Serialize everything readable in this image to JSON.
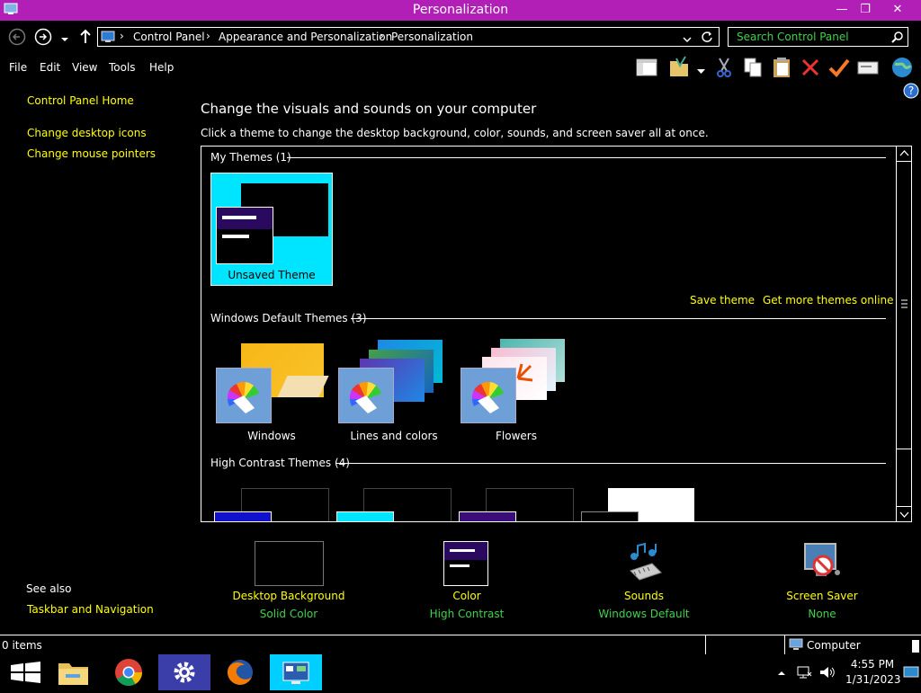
{
  "window": {
    "title": "Personalization",
    "min": "—",
    "max": "❐",
    "close": "✕"
  },
  "address": {
    "crumbs": [
      "Control Panel",
      "Appearance and Personalization",
      "Personalization"
    ],
    "sep": "›"
  },
  "search": {
    "placeholder": "Search Control Panel"
  },
  "menu": [
    "File",
    "Edit",
    "View",
    "Tools",
    "Help"
  ],
  "sidebar": {
    "home": "Control Panel Home",
    "links": [
      "Change desktop icons",
      "Change mouse pointers"
    ],
    "see_also": "See also",
    "see_also_links": [
      "Taskbar and Navigation"
    ]
  },
  "main": {
    "heading": "Change the visuals and sounds on your computer",
    "subtitle": "Click a theme to change the desktop background, color, sounds, and screen saver all at once."
  },
  "themes": {
    "my_header": "My Themes (1)",
    "my_items": [
      "Unsaved Theme"
    ],
    "save_theme": "Save theme",
    "get_more": "Get more themes online",
    "default_header": "Windows Default Themes (3)",
    "default_items": [
      "Windows",
      "Lines and colors",
      "Flowers"
    ],
    "hc_header": "High Contrast Themes (4)"
  },
  "bottom": [
    {
      "title": "Desktop Background",
      "value": "Solid Color"
    },
    {
      "title": "Color",
      "value": "High Contrast"
    },
    {
      "title": "Sounds",
      "value": "Windows Default"
    },
    {
      "title": "Screen Saver",
      "value": "None"
    }
  ],
  "status": {
    "items": "0 items",
    "location": "Computer"
  },
  "taskbar": {
    "time": "4:55 PM",
    "date": "1/31/2023"
  },
  "colors": {
    "titlebar": "#b11fb7",
    "link": "#ffff00",
    "value": "#3fd24a",
    "selected": "#00e5ff"
  }
}
